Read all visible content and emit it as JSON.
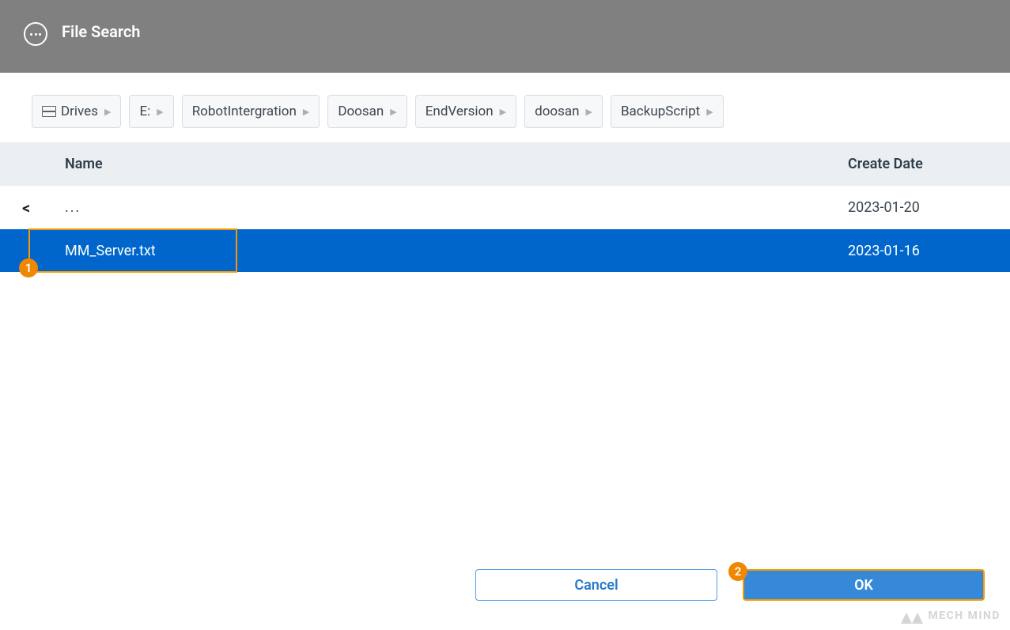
{
  "header": {
    "title": "File Search"
  },
  "breadcrumb": [
    {
      "label": "Drives",
      "hasIcon": true
    },
    {
      "label": "E:"
    },
    {
      "label": "RobotIntergration"
    },
    {
      "label": "Doosan"
    },
    {
      "label": "EndVersion"
    },
    {
      "label": "doosan"
    },
    {
      "label": "BackupScript"
    }
  ],
  "table": {
    "columns": {
      "name": "Name",
      "date": "Create Date"
    },
    "rows": [
      {
        "type": "parent",
        "name": "...",
        "date": "2023-01-20"
      },
      {
        "type": "selected",
        "name": "MM_Server.txt",
        "date": "2023-01-16"
      }
    ]
  },
  "annotations": {
    "selection_badge": "1",
    "ok_badge": "2"
  },
  "footer": {
    "cancel": "Cancel",
    "ok": "OK"
  },
  "watermark": "MECH MIND"
}
